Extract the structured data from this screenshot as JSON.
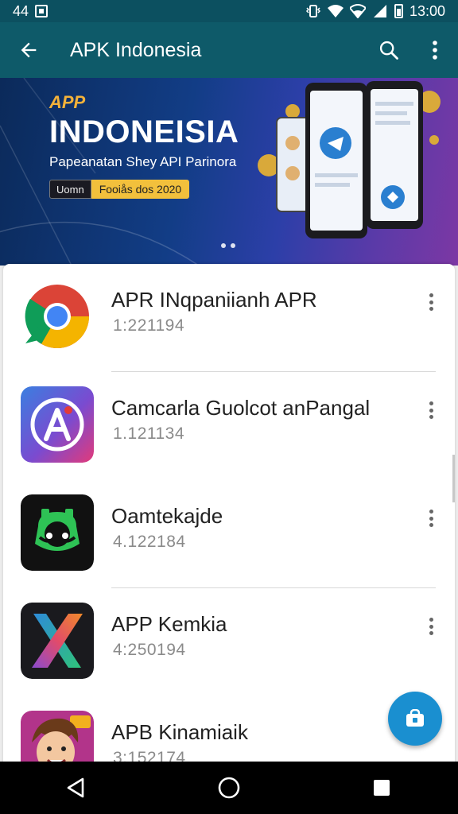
{
  "status_bar": {
    "left_text": "44",
    "time": "13:00",
    "icons": [
      "image-icon",
      "vibrate-icon",
      "wifi-icon",
      "wifi-icon",
      "signal-icon",
      "battery-icon"
    ]
  },
  "app_bar": {
    "title": "APK Indonesia",
    "icons": [
      "back-arrow-icon",
      "search-icon",
      "more-vert-icon"
    ]
  },
  "banner": {
    "brand": "APP",
    "title": "INDONEISIA",
    "subtitle": "Papeanatan Shey API Parinora",
    "badge_left": "Uomn",
    "badge_right": "Fooiås dos 2020",
    "page_count": 2
  },
  "apps": [
    {
      "name": "APR INqpaniianh APR",
      "meta": "1:221194",
      "icon": "chrome-icon"
    },
    {
      "name": "Camcarla Guolcot anPangal",
      "meta": "1.121134",
      "icon": "letter-a-icon"
    },
    {
      "name": "Oamtekajde",
      "meta": "4.122184",
      "icon": "green-robot-icon"
    },
    {
      "name": "APP Kemkia",
      "meta": "4:250194",
      "icon": "colorful-x-icon"
    },
    {
      "name": "APB Kinamiaik",
      "meta": "3:152174",
      "icon": "cartoon-kid-icon"
    }
  ],
  "fab": {
    "icon": "bag-icon"
  },
  "nav_bar": {
    "icons": [
      "back-triangle-icon",
      "home-circle-icon",
      "recents-square-icon"
    ]
  },
  "colors": {
    "status_bar": "#0c5060",
    "app_bar": "#0e5a69",
    "fab": "#1a8fd0",
    "banner_accent": "#f2c03c"
  }
}
